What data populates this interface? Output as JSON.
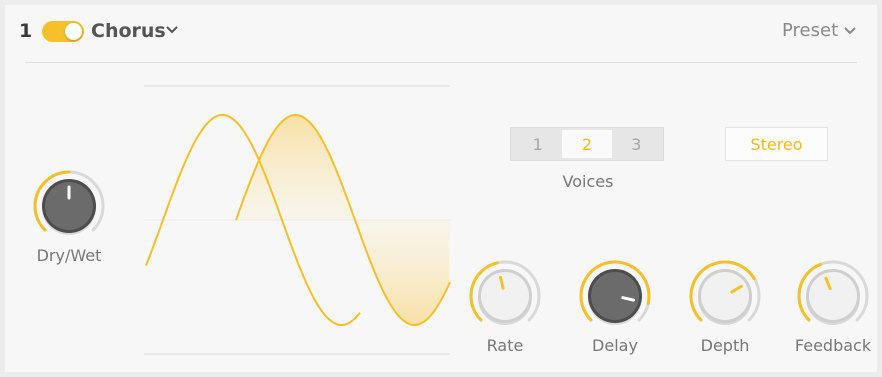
{
  "header": {
    "slot_number": "1",
    "effect_name": "Chorus",
    "preset_label": "Preset",
    "enabled": true
  },
  "voices": {
    "options": [
      "1",
      "2",
      "3"
    ],
    "selected": "2",
    "label": "Voices"
  },
  "stereo_label": "Stereo",
  "knobs": {
    "dry_wet": {
      "label": "Dry/Wet"
    },
    "rate": {
      "label": "Rate"
    },
    "delay": {
      "label": "Delay"
    },
    "depth": {
      "label": "Depth"
    },
    "feedback": {
      "label": "Feedback"
    }
  },
  "colors": {
    "accent": "#f5c02a",
    "text": "#777777"
  }
}
